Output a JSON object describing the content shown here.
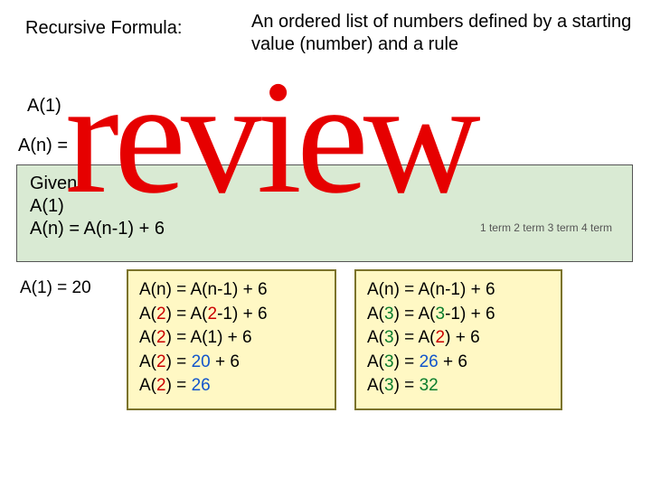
{
  "title": "Recursive Formula:",
  "definition": "An ordered list of numbers defined by a starting value (number) and a rule",
  "a1_label": "A(1)",
  "an_rule": "A(n) =",
  "green": {
    "line1": "Given:",
    "line2": "A(1)",
    "line3": "A(n) = A(n-1) +  6",
    "hint": "1  term   2   term    3   term   4  term"
  },
  "col_a1": "A(1) = 20",
  "box2": {
    "l1": "A(n) = A(n-1) +  6",
    "l2a": "A(",
    "l2b": "2",
    "l2c": ") =  A(",
    "l2d": "2",
    "l2e": "-1) +  6",
    "l3a": "A(",
    "l3b": "2",
    "l3c": ") =  A(1) +  6",
    "l4a": "A(",
    "l4b": "2",
    "l4c": ") =  ",
    "l4d": "20",
    "l4e": "  +  6",
    "l5a": "A(",
    "l5b": "2",
    "l5c": ") =  ",
    "l5d": "26"
  },
  "box3": {
    "l1": "A(n) =  A(n-1) +  6",
    "l2a": "A(",
    "l2b": "3",
    "l2c": ") =  A(",
    "l2d": "3",
    "l2e": "-1) +  6",
    "l3a": "A(",
    "l3b": "3",
    "l3c": ") =  A(",
    "l3d": "2",
    "l3e": ") +  6",
    "l4a": "A(",
    "l4b": "3",
    "l4c": ") =  ",
    "l4d": "26",
    "l4e": " +  6",
    "l5a": "A(",
    "l5b": "3",
    "l5c": ") =   ",
    "l5d": "32"
  },
  "overlay": "review"
}
